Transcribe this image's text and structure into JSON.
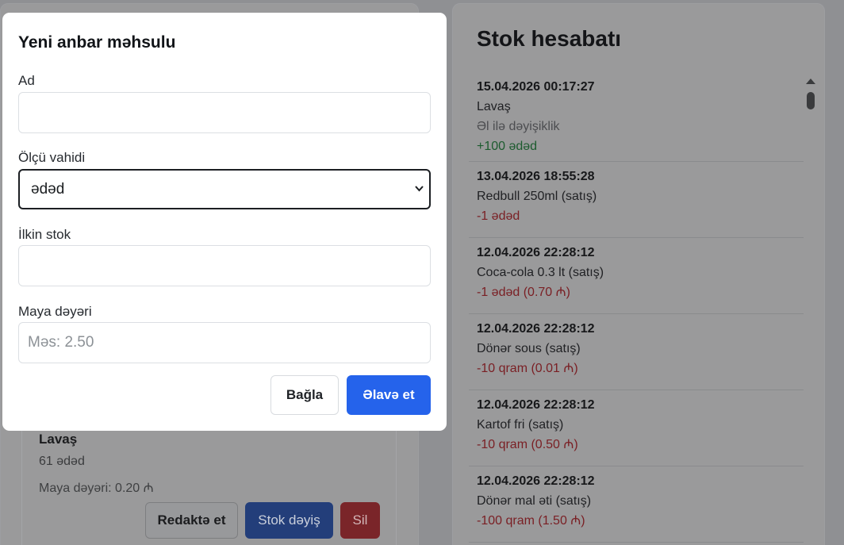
{
  "modal": {
    "title": "Yeni anbar məhsulu",
    "name_label": "Ad",
    "name_value": "",
    "unit_label": "Ölçü vahidi",
    "unit_value": "ədəd",
    "initial_stock_label": "İlkin stok",
    "initial_stock_value": "",
    "cost_label": "Maya dəyəri",
    "cost_placeholder": "Məs: 2.50",
    "close_label": "Bağla",
    "add_label": "Əlavə et"
  },
  "product_card": {
    "name": "Lavaş",
    "quantity": "61 ədəd",
    "cost": "Maya dəyəri: 0.20 ₼",
    "edit_label": "Redaktə et",
    "stock_change_label": "Stok dəyiş",
    "delete_label": "Sil"
  },
  "stock_report": {
    "title": "Stok hesabatı",
    "entries": [
      {
        "date": "15.04.2026 00:17:27",
        "name": "Lavaş",
        "note": "Əl ilə dəyişiklik",
        "delta": "+100 ədəd",
        "positive": true
      },
      {
        "date": "13.04.2026 18:55:28",
        "name": "Redbull 250ml (satış)",
        "delta": "-1 ədəd",
        "positive": false
      },
      {
        "date": "12.04.2026 22:28:12",
        "name": "Coca-cola 0.3 lt (satış)",
        "delta": "-1 ədəd (0.70 ₼)",
        "positive": false
      },
      {
        "date": "12.04.2026 22:28:12",
        "name": "Dönər sous (satış)",
        "delta": "-10 qram (0.01 ₼)",
        "positive": false
      },
      {
        "date": "12.04.2026 22:28:12",
        "name": "Kartof fri (satış)",
        "delta": "-10 qram (0.50 ₼)",
        "positive": false
      },
      {
        "date": "12.04.2026 22:28:12",
        "name": "Dönər mal əti (satış)",
        "delta": "-100 qram (1.50 ₼)",
        "positive": false
      }
    ]
  },
  "colors": {
    "primary": "#2563eb",
    "danger": "#dc3545",
    "success": "#198754",
    "overlay": "#8f9093"
  },
  "icons": {
    "select_chevron": "chevron-down-icon",
    "scroll_up": "scroll-up-arrow-icon"
  }
}
